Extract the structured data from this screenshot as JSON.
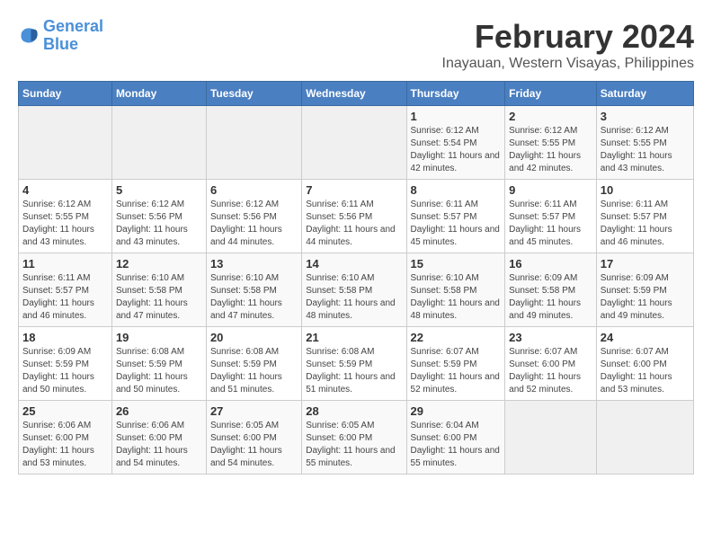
{
  "logo": {
    "line1": "General",
    "line2": "Blue"
  },
  "title": "February 2024",
  "subtitle": "Inayauan, Western Visayas, Philippines",
  "days_of_week": [
    "Sunday",
    "Monday",
    "Tuesday",
    "Wednesday",
    "Thursday",
    "Friday",
    "Saturday"
  ],
  "weeks": [
    [
      {
        "day": "",
        "info": ""
      },
      {
        "day": "",
        "info": ""
      },
      {
        "day": "",
        "info": ""
      },
      {
        "day": "",
        "info": ""
      },
      {
        "day": "1",
        "info": "Sunrise: 6:12 AM\nSunset: 5:54 PM\nDaylight: 11 hours and 42 minutes."
      },
      {
        "day": "2",
        "info": "Sunrise: 6:12 AM\nSunset: 5:55 PM\nDaylight: 11 hours and 42 minutes."
      },
      {
        "day": "3",
        "info": "Sunrise: 6:12 AM\nSunset: 5:55 PM\nDaylight: 11 hours and 43 minutes."
      }
    ],
    [
      {
        "day": "4",
        "info": "Sunrise: 6:12 AM\nSunset: 5:55 PM\nDaylight: 11 hours and 43 minutes."
      },
      {
        "day": "5",
        "info": "Sunrise: 6:12 AM\nSunset: 5:56 PM\nDaylight: 11 hours and 43 minutes."
      },
      {
        "day": "6",
        "info": "Sunrise: 6:12 AM\nSunset: 5:56 PM\nDaylight: 11 hours and 44 minutes."
      },
      {
        "day": "7",
        "info": "Sunrise: 6:11 AM\nSunset: 5:56 PM\nDaylight: 11 hours and 44 minutes."
      },
      {
        "day": "8",
        "info": "Sunrise: 6:11 AM\nSunset: 5:57 PM\nDaylight: 11 hours and 45 minutes."
      },
      {
        "day": "9",
        "info": "Sunrise: 6:11 AM\nSunset: 5:57 PM\nDaylight: 11 hours and 45 minutes."
      },
      {
        "day": "10",
        "info": "Sunrise: 6:11 AM\nSunset: 5:57 PM\nDaylight: 11 hours and 46 minutes."
      }
    ],
    [
      {
        "day": "11",
        "info": "Sunrise: 6:11 AM\nSunset: 5:57 PM\nDaylight: 11 hours and 46 minutes."
      },
      {
        "day": "12",
        "info": "Sunrise: 6:10 AM\nSunset: 5:58 PM\nDaylight: 11 hours and 47 minutes."
      },
      {
        "day": "13",
        "info": "Sunrise: 6:10 AM\nSunset: 5:58 PM\nDaylight: 11 hours and 47 minutes."
      },
      {
        "day": "14",
        "info": "Sunrise: 6:10 AM\nSunset: 5:58 PM\nDaylight: 11 hours and 48 minutes."
      },
      {
        "day": "15",
        "info": "Sunrise: 6:10 AM\nSunset: 5:58 PM\nDaylight: 11 hours and 48 minutes."
      },
      {
        "day": "16",
        "info": "Sunrise: 6:09 AM\nSunset: 5:58 PM\nDaylight: 11 hours and 49 minutes."
      },
      {
        "day": "17",
        "info": "Sunrise: 6:09 AM\nSunset: 5:59 PM\nDaylight: 11 hours and 49 minutes."
      }
    ],
    [
      {
        "day": "18",
        "info": "Sunrise: 6:09 AM\nSunset: 5:59 PM\nDaylight: 11 hours and 50 minutes."
      },
      {
        "day": "19",
        "info": "Sunrise: 6:08 AM\nSunset: 5:59 PM\nDaylight: 11 hours and 50 minutes."
      },
      {
        "day": "20",
        "info": "Sunrise: 6:08 AM\nSunset: 5:59 PM\nDaylight: 11 hours and 51 minutes."
      },
      {
        "day": "21",
        "info": "Sunrise: 6:08 AM\nSunset: 5:59 PM\nDaylight: 11 hours and 51 minutes."
      },
      {
        "day": "22",
        "info": "Sunrise: 6:07 AM\nSunset: 5:59 PM\nDaylight: 11 hours and 52 minutes."
      },
      {
        "day": "23",
        "info": "Sunrise: 6:07 AM\nSunset: 6:00 PM\nDaylight: 11 hours and 52 minutes."
      },
      {
        "day": "24",
        "info": "Sunrise: 6:07 AM\nSunset: 6:00 PM\nDaylight: 11 hours and 53 minutes."
      }
    ],
    [
      {
        "day": "25",
        "info": "Sunrise: 6:06 AM\nSunset: 6:00 PM\nDaylight: 11 hours and 53 minutes."
      },
      {
        "day": "26",
        "info": "Sunrise: 6:06 AM\nSunset: 6:00 PM\nDaylight: 11 hours and 54 minutes."
      },
      {
        "day": "27",
        "info": "Sunrise: 6:05 AM\nSunset: 6:00 PM\nDaylight: 11 hours and 54 minutes."
      },
      {
        "day": "28",
        "info": "Sunrise: 6:05 AM\nSunset: 6:00 PM\nDaylight: 11 hours and 55 minutes."
      },
      {
        "day": "29",
        "info": "Sunrise: 6:04 AM\nSunset: 6:00 PM\nDaylight: 11 hours and 55 minutes."
      },
      {
        "day": "",
        "info": ""
      },
      {
        "day": "",
        "info": ""
      }
    ]
  ]
}
